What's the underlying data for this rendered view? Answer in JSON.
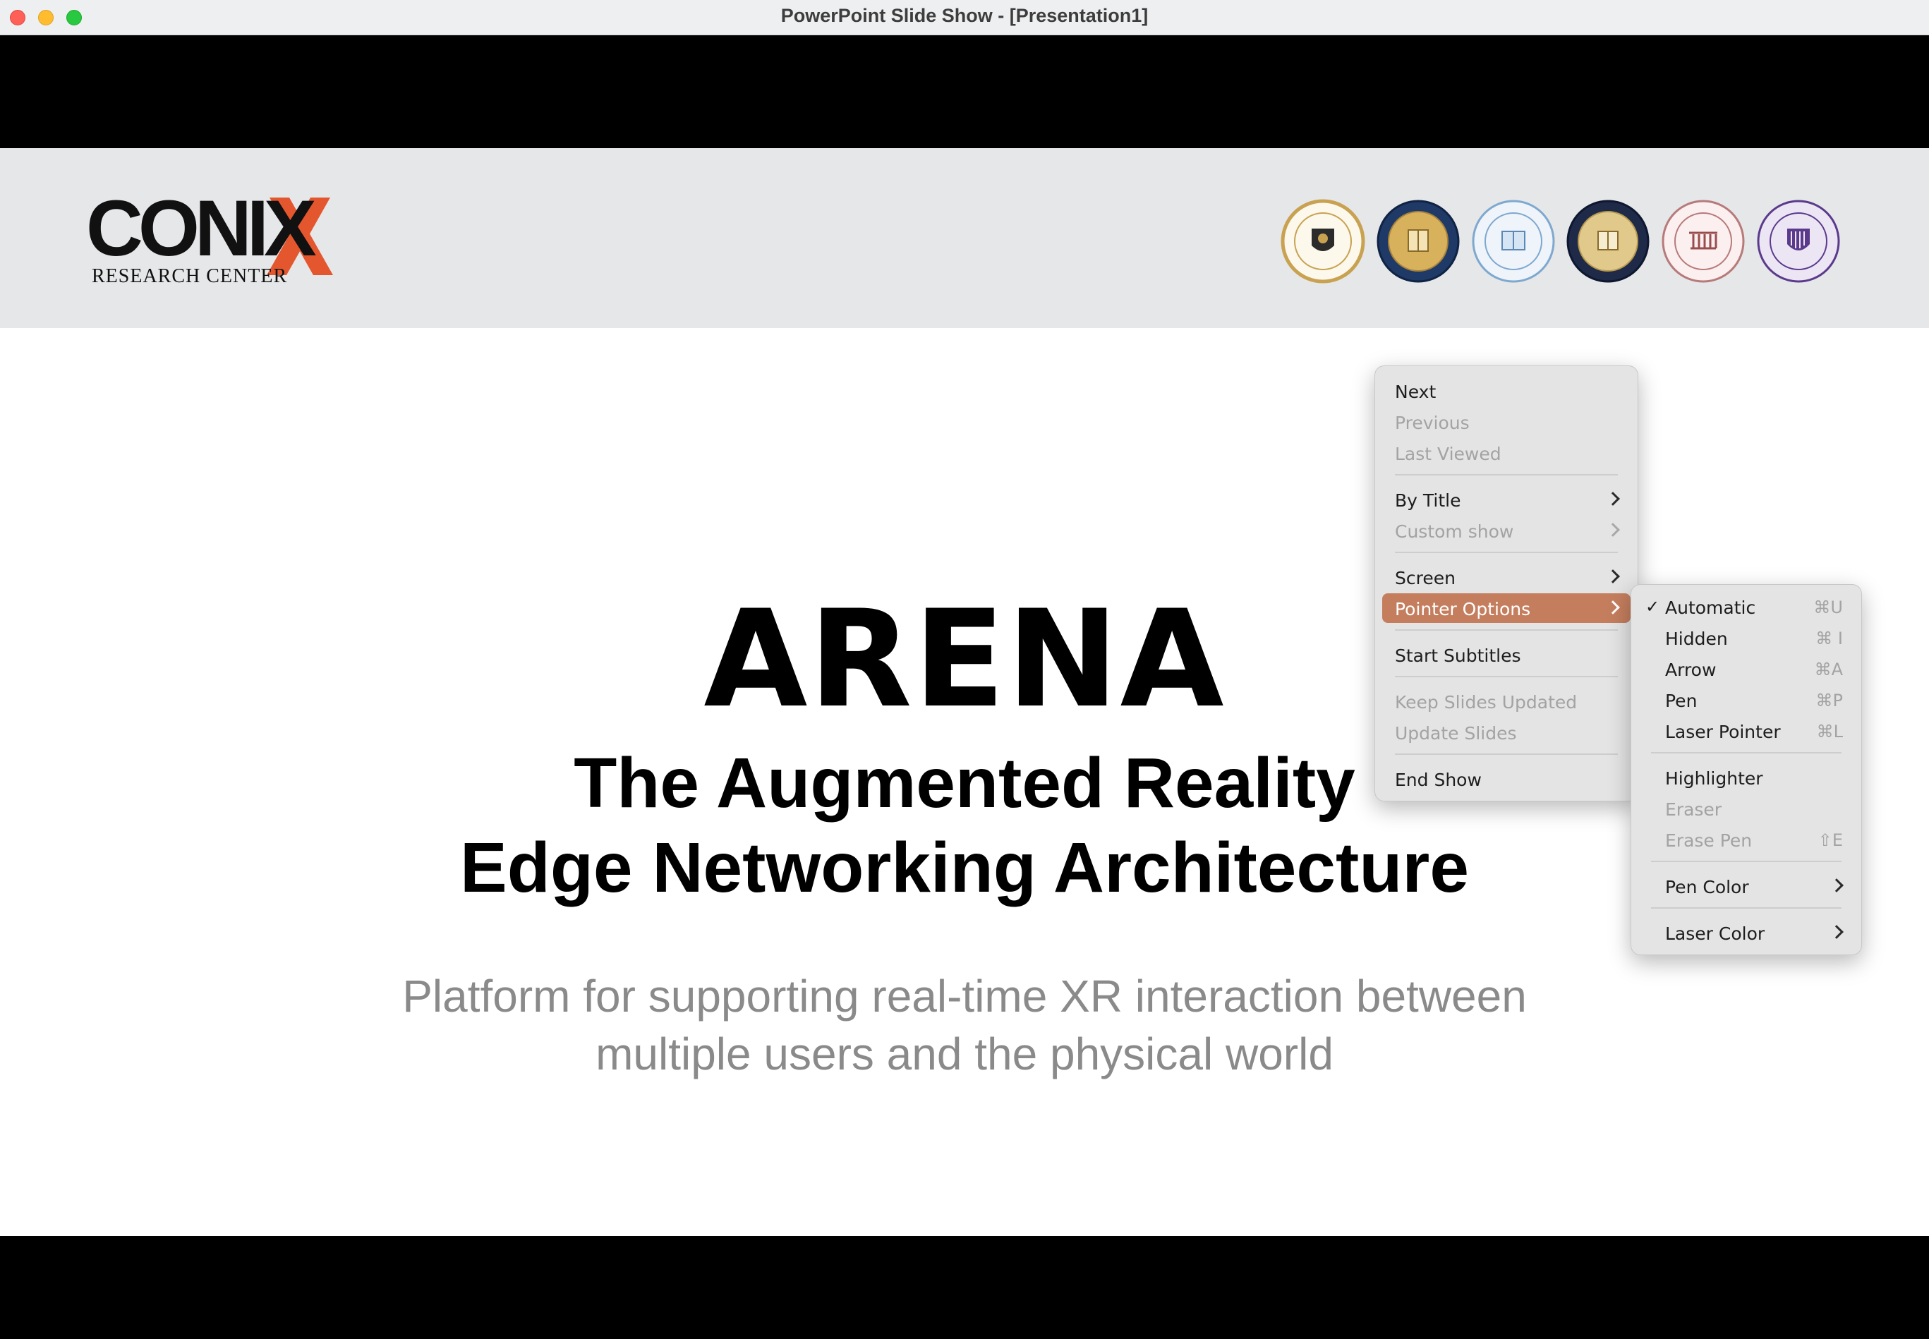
{
  "window": {
    "title": "PowerPoint Slide Show - [Presentation1]"
  },
  "slide": {
    "logo": {
      "wordmark": "CONIX",
      "subtitle": "RESEARCH CENTER",
      "accent_color": "#e4572e"
    },
    "seals": [
      {
        "name": "carnegie-mellon-university-seal",
        "ring": "#c8a251",
        "fill": "#fdf8ec"
      },
      {
        "name": "uc-berkeley-seal",
        "ring": "#1f3a66",
        "fill": "#d7b15c"
      },
      {
        "name": "ucla-seal",
        "ring": "#7fa8cf",
        "fill": "#eef4fa"
      },
      {
        "name": "uc-san-diego-seal",
        "ring": "#1e2a47",
        "fill": "#e1c98c"
      },
      {
        "name": "university-of-southern-california-seal",
        "ring": "#b77a7a",
        "fill": "#fbefef"
      },
      {
        "name": "university-of-washington-seal",
        "ring": "#5b3a8c",
        "fill": "#ece6f4"
      }
    ],
    "title": "ARENA",
    "subtitle_lines": [
      "The Augmented Reality",
      "Edge Networking Architecture"
    ],
    "tagline_lines": [
      "Platform for supporting real-time XR interaction between",
      "multiple users and the physical world"
    ]
  },
  "context_menu": {
    "highlight_color": "#c47e5e",
    "items": [
      {
        "label": "Next",
        "enabled": true
      },
      {
        "label": "Previous",
        "enabled": false
      },
      {
        "label": "Last Viewed",
        "enabled": false
      },
      {
        "label": "By Title",
        "enabled": true,
        "submenu": true
      },
      {
        "label": "Custom show",
        "enabled": false,
        "submenu": true
      },
      {
        "label": "Screen",
        "enabled": true,
        "submenu": true
      },
      {
        "label": "Pointer Options",
        "enabled": true,
        "submenu": true,
        "highlighted": true
      },
      {
        "label": "Start Subtitles",
        "enabled": true
      },
      {
        "label": "Keep Slides Updated",
        "enabled": false
      },
      {
        "label": "Update Slides",
        "enabled": false
      },
      {
        "label": "End Show",
        "enabled": true
      }
    ]
  },
  "pointer_submenu": {
    "items": [
      {
        "label": "Automatic",
        "shortcut": "⌘U",
        "checked": true,
        "enabled": true
      },
      {
        "label": "Hidden",
        "shortcut": "⌘ I",
        "enabled": true
      },
      {
        "label": "Arrow",
        "shortcut": "⌘A",
        "enabled": true
      },
      {
        "label": "Pen",
        "shortcut": "⌘P",
        "enabled": true
      },
      {
        "label": "Laser Pointer",
        "shortcut": "⌘L",
        "enabled": true
      },
      {
        "label": "Highlighter",
        "enabled": true
      },
      {
        "label": "Eraser",
        "enabled": false
      },
      {
        "label": "Erase Pen",
        "shortcut": "⇧E",
        "enabled": false
      },
      {
        "label": "Pen Color",
        "enabled": true,
        "submenu": true
      },
      {
        "label": "Laser Color",
        "enabled": true,
        "submenu": true
      }
    ]
  }
}
